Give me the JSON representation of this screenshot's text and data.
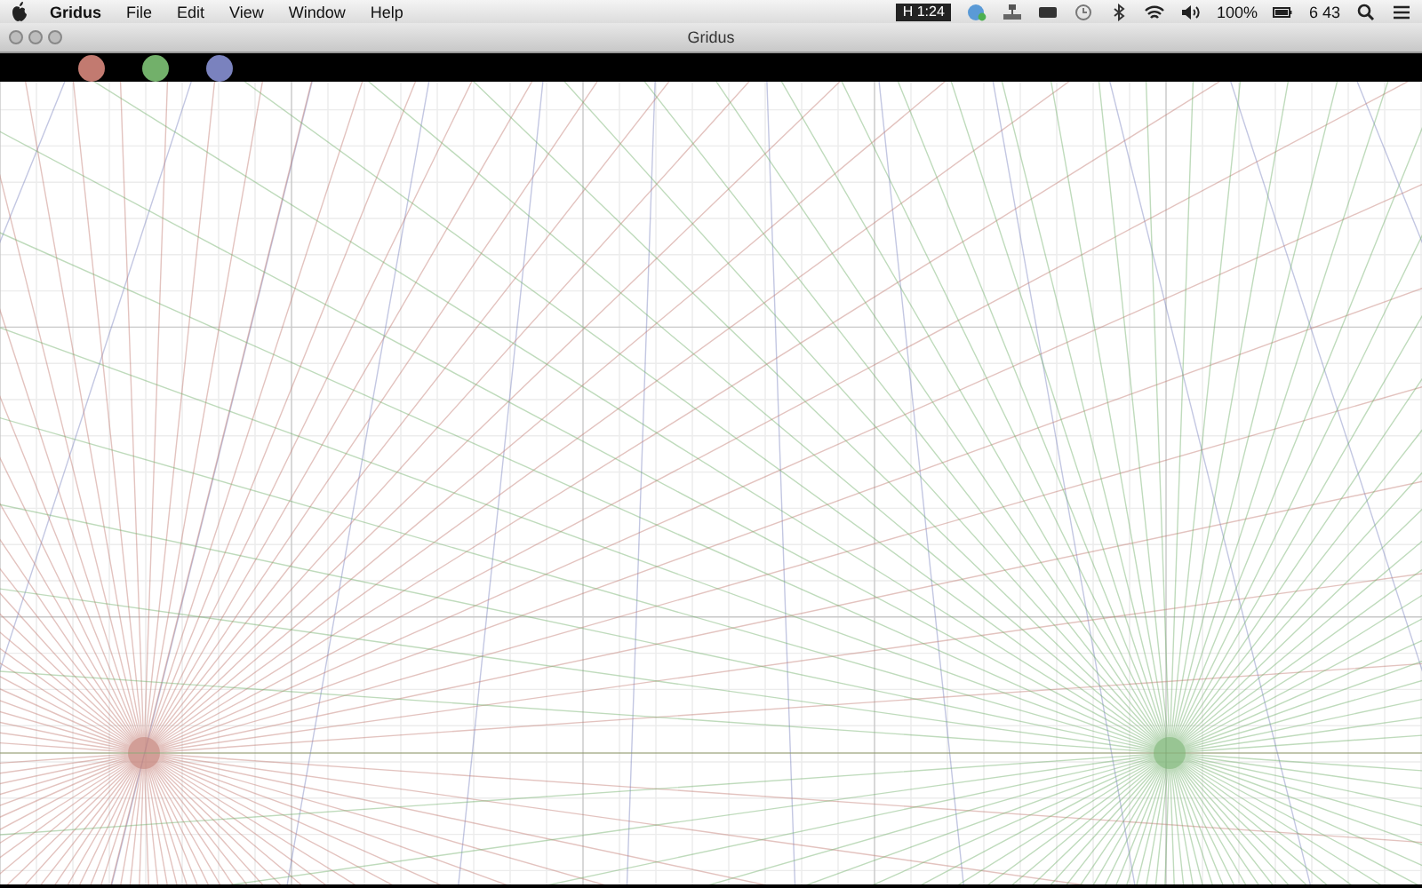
{
  "menu_bar": {
    "app_name": "Gridus",
    "menus": [
      "File",
      "Edit",
      "View",
      "Window",
      "Help"
    ],
    "status": {
      "timer": "H 1:24",
      "battery": "100%",
      "clock": "6 43"
    }
  },
  "window": {
    "title": "Gridus"
  },
  "toolbar": {
    "swatches": [
      {
        "color": "#c27a70"
      },
      {
        "color": "#72b06a"
      },
      {
        "color": "#7a82be"
      }
    ]
  }
}
